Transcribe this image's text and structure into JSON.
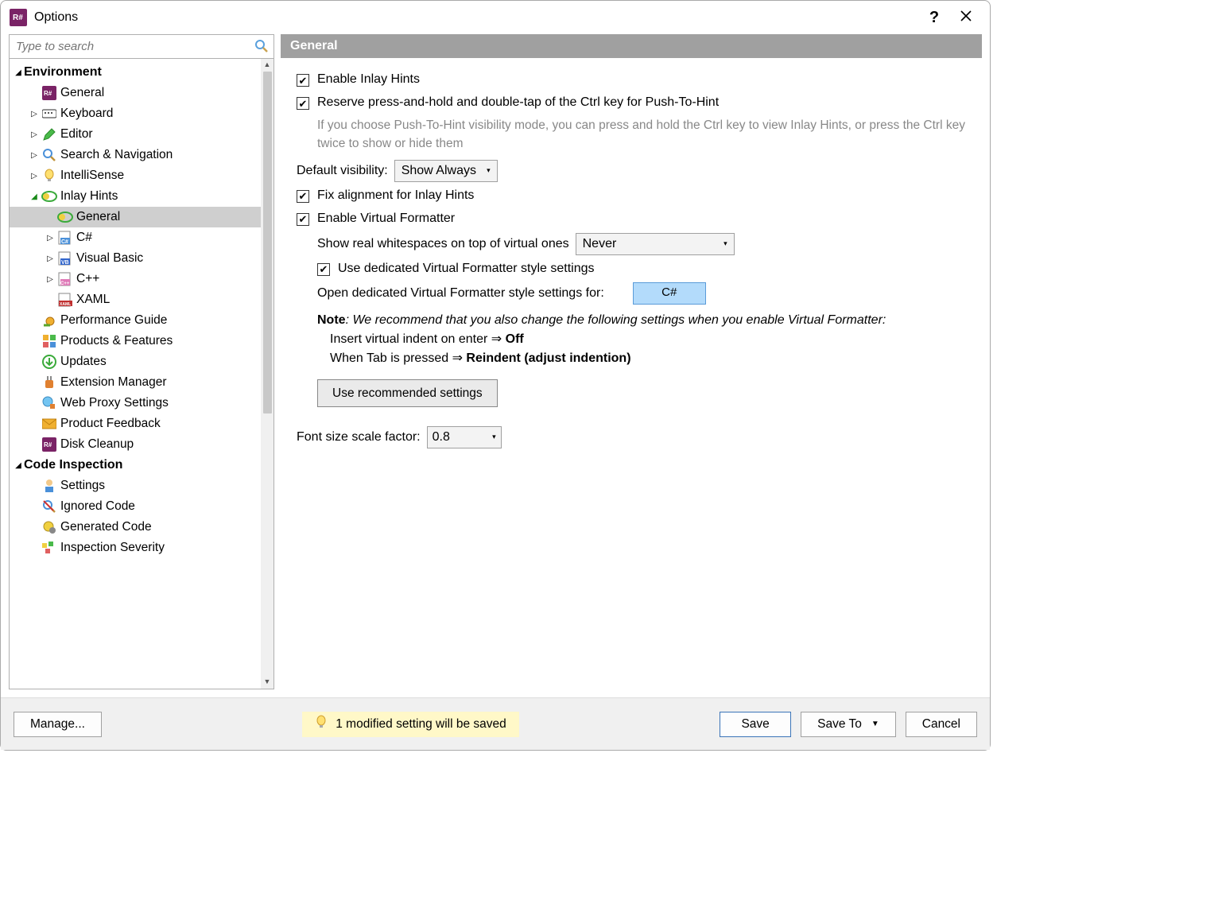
{
  "window": {
    "title": "Options"
  },
  "search": {
    "placeholder": "Type to search"
  },
  "tree": {
    "sections": [
      {
        "label": "Environment",
        "expanded": true
      },
      {
        "label": "Code Inspection",
        "expanded": true
      }
    ],
    "items": {
      "general": "General",
      "keyboard": "Keyboard",
      "editor": "Editor",
      "searchnav": "Search & Navigation",
      "intellisense": "IntelliSense",
      "inlayhints": "Inlay Hints",
      "ih_general": "General",
      "csharp": "C#",
      "vb": "Visual Basic",
      "cpp": "C++",
      "xaml": "XAML",
      "perfguide": "Performance Guide",
      "products": "Products & Features",
      "updates": "Updates",
      "extmgr": "Extension Manager",
      "proxy": "Web Proxy Settings",
      "feedback": "Product Feedback",
      "diskclean": "Disk Cleanup",
      "ci_settings": "Settings",
      "ci_ignored": "Ignored Code",
      "ci_generated": "Generated Code",
      "ci_severity": "Inspection Severity"
    }
  },
  "panel": {
    "header": "General",
    "enable_inlay": "Enable Inlay Hints",
    "reserve_ctrl": "Reserve press-and-hold and double-tap of the Ctrl key for Push-To-Hint",
    "reserve_help": "If you choose Push-To-Hint visibility mode, you can press and hold the Ctrl key to view Inlay Hints, or press the Ctrl key twice to show or hide them",
    "default_vis_label": "Default visibility:",
    "default_vis_value": "Show Always",
    "fix_align": "Fix alignment for Inlay Hints",
    "enable_vf": "Enable Virtual Formatter",
    "show_real_ws_label": "Show real whitespaces on top of virtual ones",
    "show_real_ws_value": "Never",
    "use_dedicated": "Use dedicated Virtual Formatter style settings",
    "open_dedicated": "Open dedicated Virtual Formatter style settings for:",
    "csharp_btn": "C#",
    "note_label": "Note",
    "note_text": ": We recommend that you also change the following settings when you enable Virtual Formatter:",
    "note_li1_a": "Insert virtual indent on enter ⇒ ",
    "note_li1_b": "Off",
    "note_li2_a": "When Tab is pressed ⇒ ",
    "note_li2_b": "Reindent (adjust indention)",
    "reco_btn": "Use recommended settings",
    "font_scale_label": "Font size scale factor:",
    "font_scale_value": "0.8"
  },
  "footer": {
    "manage": "Manage...",
    "status": "1 modified setting will be saved",
    "save": "Save",
    "saveto": "Save To",
    "cancel": "Cancel"
  }
}
